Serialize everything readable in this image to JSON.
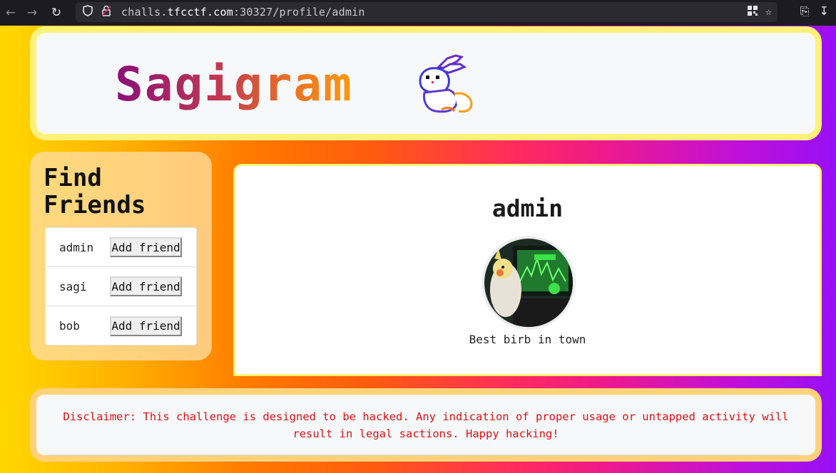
{
  "browser": {
    "url_scheme_host": "challs.",
    "url_host": "tfcctf.com",
    "url_rest": ":30327/profile/admin"
  },
  "header": {
    "title": "Sagigram",
    "logo_icon": "pixel-rabbit-icon"
  },
  "sidebar": {
    "title": "Find Friends",
    "friends": [
      {
        "name": "admin",
        "button": "Add friend"
      },
      {
        "name": "sagi",
        "button": "Add friend"
      },
      {
        "name": "bob",
        "button": "Add friend"
      }
    ]
  },
  "profile": {
    "username": "admin",
    "bio": "Best birb in town"
  },
  "footer": {
    "disclaimer": "Disclaimer: This challenge is designed to be hacked. Any indication of proper usage or untapped activity will result in legal sactions. Happy hacking!"
  },
  "colors": {
    "accent_yellow": "#fff17a",
    "disclaimer_red": "#e01010"
  }
}
